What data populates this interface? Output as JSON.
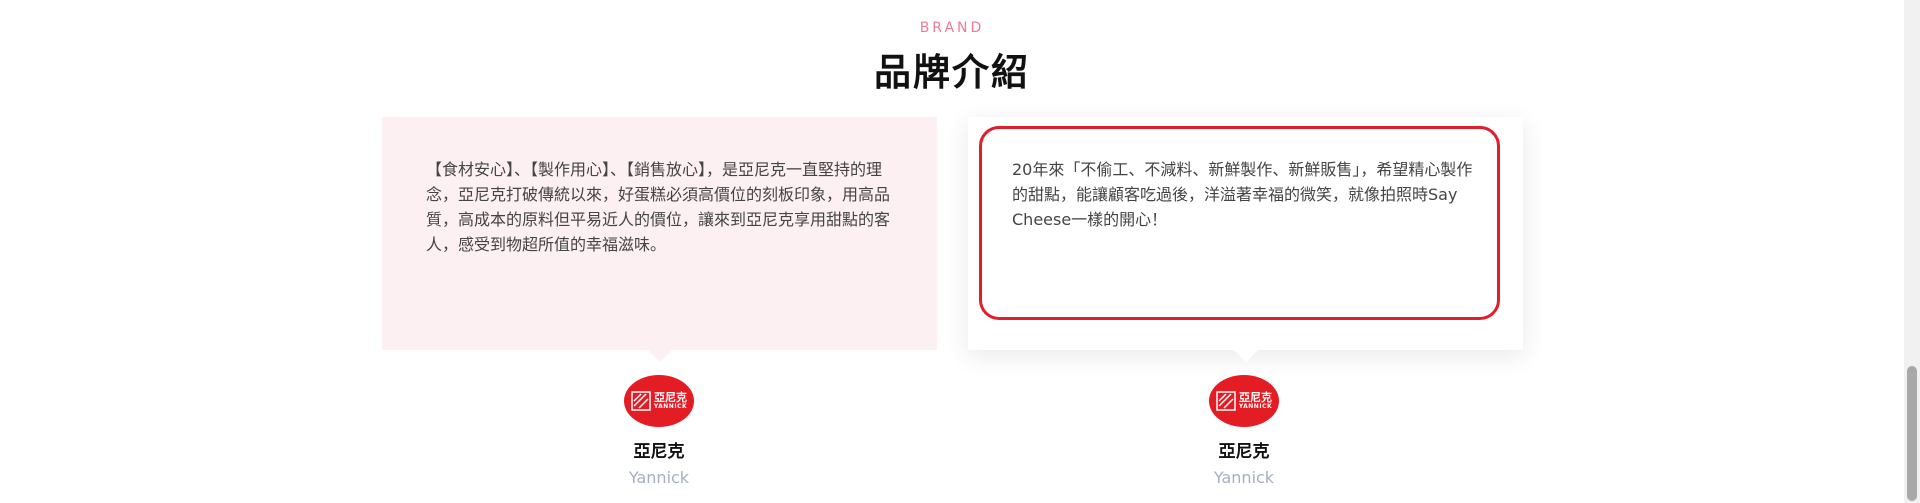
{
  "section": {
    "eyebrow": "BRAND",
    "title": "品牌介紹"
  },
  "testimonials": [
    {
      "text": "【食材安心】、【製作用心】、【銷售放心】，是亞尼克一直堅持的理念，亞尼克打破傳統以來，好蛋糕必須高價位的刻板印象，用高品質，高成本的原料但平易近人的價位，讓來到亞尼克享用甜點的客人，感受到物超所值的幸福滋味。",
      "author": {
        "logo_cn": "亞尼克",
        "logo_en": "YANNICK",
        "name": "亞尼克",
        "role": "Yannick"
      }
    },
    {
      "text": "20年來「不偷工、不減料、新鮮製作、新鮮販售」，希望精心製作的甜點，能讓顧客吃過後，洋溢著幸福的微笑，就像拍照時Say Cheese一樣的開心！",
      "author": {
        "logo_cn": "亞尼克",
        "logo_en": "YANNICK",
        "name": "亞尼克",
        "role": "Yannick"
      }
    }
  ],
  "colors": {
    "accent": "#ef7a97",
    "brand_red": "#e41c23",
    "highlight": "#e01f2d",
    "card_bg": "#fcf0f2"
  },
  "icons": {
    "logo": "yannick-logo-icon"
  }
}
